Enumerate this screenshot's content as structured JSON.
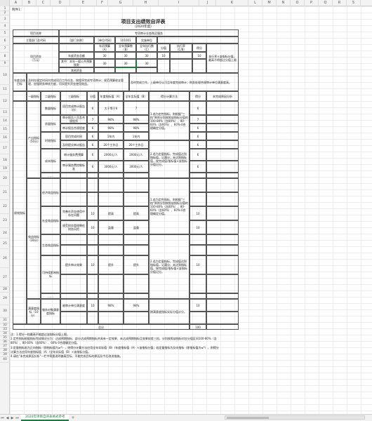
{
  "columns": [
    "A",
    "B",
    "C",
    "D",
    "E",
    "F",
    "G",
    "H",
    "I",
    "J",
    "K",
    "L",
    "M",
    "N",
    "O",
    "P",
    "Q",
    "R",
    "S"
  ],
  "rows": [
    "1",
    "2",
    "3",
    "4",
    "5",
    "6",
    "7",
    "8",
    "9",
    "10",
    "11",
    "12",
    "13",
    "14",
    "15",
    "16",
    "17",
    "18",
    "19",
    "20",
    "21",
    "22",
    "23",
    "24",
    "25",
    "26",
    "27",
    "28",
    "29",
    "30",
    "31",
    "32",
    "33",
    "34",
    "35",
    "36",
    "37",
    "38",
    "39",
    "40"
  ],
  "attach": "附件1：",
  "title": "项目支出绩效自评表",
  "subtitle": "（2020年度）",
  "header": {
    "project_name_label": "项目名称",
    "project_name": "专项审计业务购买服务",
    "dept_label": "主管部门及代码",
    "dept_code_label": "[单位代码]",
    "dept_code": "101001",
    "impl_label": "实施单位",
    "impl_value": "",
    "dept_name": "[部门名称]",
    "funds_label": "项目资金\n（万元）",
    "col_year_budget": "年初预算\n（A）",
    "col_full_budget": "全年预算数\n（B）",
    "col_full_exec": "全年执行数\n（C）",
    "col_score": "分值",
    "col_exec_rate": "执行率\n（C/B）",
    "col_score2": "得分",
    "total_label": "年度资金总额",
    "total": {
      "a": "30",
      "b": "30",
      "c": "30",
      "score": "10",
      "rate": "",
      "gain": "10"
    },
    "fiscal_label": "其中：本年一般公共预算拨款",
    "fiscal": {
      "a": "30",
      "b": "30",
      "c": "30"
    },
    "other_label": "其他资金",
    "exec_note": "执行率×该指标分值，最高不得超过分值上限",
    "gain_col": "得分"
  },
  "goal": {
    "label": "年度总体目标",
    "expected": "及时在规定时间内完成项目工作任务，按程序完成专项审计；规范预算收支管理，加强财务审核力度，切实提升资金使用效益。",
    "actual": "及时完成工作，上级单位认可且年度完成审计；财务处理合规审计单位满意度高。"
  },
  "table": {
    "col1": "一级指标",
    "col2": "二级指标",
    "col3": "三级指标",
    "col4": "分值",
    "col5": "年度指标值（A）",
    "col6": "全年实际值（B）",
    "col7": "得分计算方法",
    "col8": "得分",
    "col9": "未完成原因分析",
    "level1_perf": "绩效指标",
    "output": "产出指标（50分）",
    "benefit": "效益指标（30分）",
    "satisfy": "满意度指标（10分）",
    "perf_score": "40",
    "qty": "数量指标",
    "qual": "质量指标",
    "time": "时效指标",
    "cost": "成本指标",
    "econ": "经济效益指标",
    "social": "社会效益指标",
    "env": "生态效益指标",
    "sustain": "可持续影响指标",
    "service": "服务对象满意度指标",
    "dots": "……",
    "r1": {
      "name": "项目完成审计报告（份）",
      "score": "6",
      "target": "大于等于6",
      "actual": "7",
      "gain": "6"
    },
    "r2": {
      "name": "审计报告人员及合规程序",
      "score": "7",
      "target": "98%",
      "actual": "98%",
      "gain": "7"
    },
    "r3": {
      "name": "审计报告合规程度",
      "score": "6",
      "target": "98%",
      "actual": "98%",
      "gain": "6"
    },
    "r4": {
      "name": "项目完成时间",
      "score": "6",
      "target": "1年内",
      "actual": "1年内",
      "gain": "6"
    },
    "r5": {
      "name": "及时提交审计报告",
      "score": "6",
      "target": "20个工作日",
      "actual": "20个工作日",
      "gain": "6"
    },
    "r6": {
      "name": "审计服务费预算",
      "score": "6",
      "target": "2000元/人",
      "actual": "2000元/人",
      "gain": "6"
    },
    "r7": {
      "name": "审计服务费控制标准",
      "score": "6",
      "target": "3000元/人",
      "actual": "3000元/人",
      "gain": "6"
    },
    "r8": {
      "name": "完善在资金使用中存在问题",
      "score": "10",
      "target": "提高",
      "actual": "提高",
      "gain": "10"
    },
    "r9": {
      "name": "规范财务管理降低财务风险",
      "score": "10",
      "target": "监督",
      "actual": "监督",
      "gain": "10"
    },
    "r10": {
      "name": "提升审计效果",
      "score": "10",
      "target": "提升",
      "actual": "提升",
      "gain": "10"
    },
    "r11": {
      "name": "被审计单位满意度",
      "score": "10",
      "target": "98%",
      "actual": "98%",
      "gain": "10"
    },
    "method_a": "1.若为定性指标，则根据\"三档\"原则分别按照该指标分值的100-80%（含80%）、80-60%（含60%）、60%-0合理确定分值。",
    "method_b": "2.若为定量指标，完成值达到指标值，记满分；未达到指标值，按完成值/指标值×该指标分值记分。",
    "method_c": "1.若为定性指标，则根据\"三档\"原则分别按照该指标分值的100-80%（含80%）、80-60%（含60%）、60%-0合理确定分值。",
    "method_d": "2.若为定量指标，完成值达到指标值，记满分；未达到指标值，按完成值/指标值×该指标分值记分。",
    "method_e": "按满意度指标实际分值计分。",
    "total_label": "总分",
    "total_score": "100"
  },
  "notes": [
    "注：1.得分一档最高不能超过该指标分值上限。",
    "2.定性指标根据指标完成情况分为：达成预期指标、部分达成预期指标并具有一定效果、未达成预期指标且效果较差三档，分别按照该指标对应分值区间100-80%（含80%）、80-60%（含60%）、60%-0合理确定分值。",
    "3.定量指标若为正向指标（即指标值为≥*），则得分计算方法应用全年实际值（B）/年度指标值（A）×该指标分值；若定量指标为反向指标（即指标值为≤*），则得分计算方法应用年度指标值（A）/全年实际值（B）×该指标分值。",
    "4.请在\"未完成原因分析\"一栏中简要说明偏离目标、不能完成目标的原因及今后改进措施。"
  ],
  "tab": "2020年项目自评表格式参考",
  "add_icon": "plus-icon"
}
